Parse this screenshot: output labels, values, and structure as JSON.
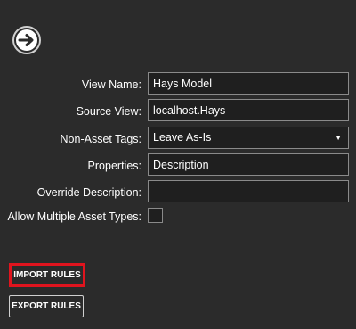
{
  "nav": {
    "icon": "arrow-right-circle-icon"
  },
  "form": {
    "view_name": {
      "label": "View Name:",
      "value": "Hays Model"
    },
    "source_view": {
      "label": "Source View:",
      "value": "localhost.Hays"
    },
    "non_asset_tags": {
      "label": "Non-Asset Tags:",
      "value": "Leave As-Is"
    },
    "properties": {
      "label": "Properties:",
      "value": "Description"
    },
    "override_description": {
      "label": "Override Description:",
      "value": ""
    },
    "allow_multiple": {
      "label": "Allow Multiple Asset Types:",
      "checked": false
    }
  },
  "actions": {
    "import_label": "IMPORT RULES",
    "export_label": "EXPORT RULES"
  },
  "colors": {
    "background": "#2b2b2b",
    "field_bg": "#1f1f1f",
    "field_border": "#8a8a8a",
    "highlight": "#e0141e"
  }
}
